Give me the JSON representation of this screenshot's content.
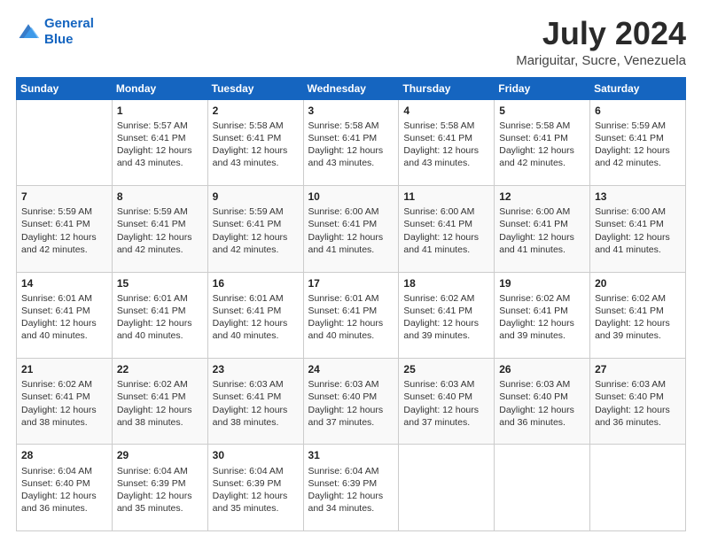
{
  "header": {
    "logo_line1": "General",
    "logo_line2": "Blue",
    "main_title": "July 2024",
    "subtitle": "Mariguitar, Sucre, Venezuela"
  },
  "calendar": {
    "weekdays": [
      "Sunday",
      "Monday",
      "Tuesday",
      "Wednesday",
      "Thursday",
      "Friday",
      "Saturday"
    ],
    "weeks": [
      [
        {
          "num": "",
          "info": ""
        },
        {
          "num": "1",
          "info": "Sunrise: 5:57 AM\nSunset: 6:41 PM\nDaylight: 12 hours\nand 43 minutes."
        },
        {
          "num": "2",
          "info": "Sunrise: 5:58 AM\nSunset: 6:41 PM\nDaylight: 12 hours\nand 43 minutes."
        },
        {
          "num": "3",
          "info": "Sunrise: 5:58 AM\nSunset: 6:41 PM\nDaylight: 12 hours\nand 43 minutes."
        },
        {
          "num": "4",
          "info": "Sunrise: 5:58 AM\nSunset: 6:41 PM\nDaylight: 12 hours\nand 43 minutes."
        },
        {
          "num": "5",
          "info": "Sunrise: 5:58 AM\nSunset: 6:41 PM\nDaylight: 12 hours\nand 42 minutes."
        },
        {
          "num": "6",
          "info": "Sunrise: 5:59 AM\nSunset: 6:41 PM\nDaylight: 12 hours\nand 42 minutes."
        }
      ],
      [
        {
          "num": "7",
          "info": "Sunrise: 5:59 AM\nSunset: 6:41 PM\nDaylight: 12 hours\nand 42 minutes."
        },
        {
          "num": "8",
          "info": "Sunrise: 5:59 AM\nSunset: 6:41 PM\nDaylight: 12 hours\nand 42 minutes."
        },
        {
          "num": "9",
          "info": "Sunrise: 5:59 AM\nSunset: 6:41 PM\nDaylight: 12 hours\nand 42 minutes."
        },
        {
          "num": "10",
          "info": "Sunrise: 6:00 AM\nSunset: 6:41 PM\nDaylight: 12 hours\nand 41 minutes."
        },
        {
          "num": "11",
          "info": "Sunrise: 6:00 AM\nSunset: 6:41 PM\nDaylight: 12 hours\nand 41 minutes."
        },
        {
          "num": "12",
          "info": "Sunrise: 6:00 AM\nSunset: 6:41 PM\nDaylight: 12 hours\nand 41 minutes."
        },
        {
          "num": "13",
          "info": "Sunrise: 6:00 AM\nSunset: 6:41 PM\nDaylight: 12 hours\nand 41 minutes."
        }
      ],
      [
        {
          "num": "14",
          "info": "Sunrise: 6:01 AM\nSunset: 6:41 PM\nDaylight: 12 hours\nand 40 minutes."
        },
        {
          "num": "15",
          "info": "Sunrise: 6:01 AM\nSunset: 6:41 PM\nDaylight: 12 hours\nand 40 minutes."
        },
        {
          "num": "16",
          "info": "Sunrise: 6:01 AM\nSunset: 6:41 PM\nDaylight: 12 hours\nand 40 minutes."
        },
        {
          "num": "17",
          "info": "Sunrise: 6:01 AM\nSunset: 6:41 PM\nDaylight: 12 hours\nand 40 minutes."
        },
        {
          "num": "18",
          "info": "Sunrise: 6:02 AM\nSunset: 6:41 PM\nDaylight: 12 hours\nand 39 minutes."
        },
        {
          "num": "19",
          "info": "Sunrise: 6:02 AM\nSunset: 6:41 PM\nDaylight: 12 hours\nand 39 minutes."
        },
        {
          "num": "20",
          "info": "Sunrise: 6:02 AM\nSunset: 6:41 PM\nDaylight: 12 hours\nand 39 minutes."
        }
      ],
      [
        {
          "num": "21",
          "info": "Sunrise: 6:02 AM\nSunset: 6:41 PM\nDaylight: 12 hours\nand 38 minutes."
        },
        {
          "num": "22",
          "info": "Sunrise: 6:02 AM\nSunset: 6:41 PM\nDaylight: 12 hours\nand 38 minutes."
        },
        {
          "num": "23",
          "info": "Sunrise: 6:03 AM\nSunset: 6:41 PM\nDaylight: 12 hours\nand 38 minutes."
        },
        {
          "num": "24",
          "info": "Sunrise: 6:03 AM\nSunset: 6:40 PM\nDaylight: 12 hours\nand 37 minutes."
        },
        {
          "num": "25",
          "info": "Sunrise: 6:03 AM\nSunset: 6:40 PM\nDaylight: 12 hours\nand 37 minutes."
        },
        {
          "num": "26",
          "info": "Sunrise: 6:03 AM\nSunset: 6:40 PM\nDaylight: 12 hours\nand 36 minutes."
        },
        {
          "num": "27",
          "info": "Sunrise: 6:03 AM\nSunset: 6:40 PM\nDaylight: 12 hours\nand 36 minutes."
        }
      ],
      [
        {
          "num": "28",
          "info": "Sunrise: 6:04 AM\nSunset: 6:40 PM\nDaylight: 12 hours\nand 36 minutes."
        },
        {
          "num": "29",
          "info": "Sunrise: 6:04 AM\nSunset: 6:39 PM\nDaylight: 12 hours\nand 35 minutes."
        },
        {
          "num": "30",
          "info": "Sunrise: 6:04 AM\nSunset: 6:39 PM\nDaylight: 12 hours\nand 35 minutes."
        },
        {
          "num": "31",
          "info": "Sunrise: 6:04 AM\nSunset: 6:39 PM\nDaylight: 12 hours\nand 34 minutes."
        },
        {
          "num": "",
          "info": ""
        },
        {
          "num": "",
          "info": ""
        },
        {
          "num": "",
          "info": ""
        }
      ]
    ]
  }
}
